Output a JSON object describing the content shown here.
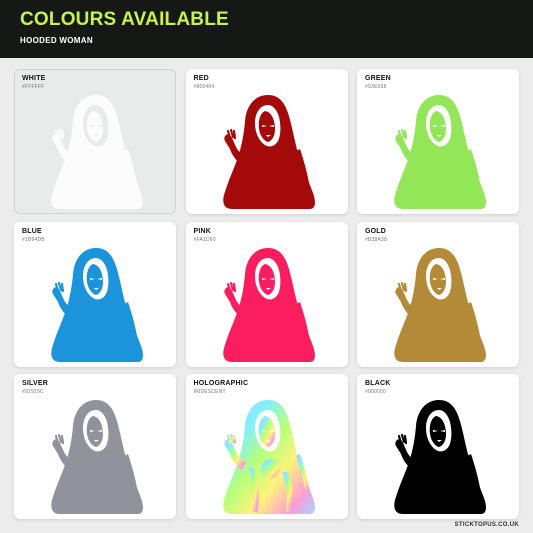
{
  "header": {
    "title": "COLOURS AVAILABLE",
    "subtitle": "HOODED WOMAN"
  },
  "colors": [
    {
      "name": "WHITE",
      "hex_label": "#FFFFFF",
      "fill": "#FFFFFF"
    },
    {
      "name": "RED",
      "hex_label": "#800404",
      "fill": "#A40A0A"
    },
    {
      "name": "GREEN",
      "hex_label": "#93E658",
      "fill": "#93E658"
    },
    {
      "name": "BLUE",
      "hex_label": "#1B94DB",
      "fill": "#1B94DB"
    },
    {
      "name": "PINK",
      "hex_label": "#FA1D60",
      "fill": "#FA1D60"
    },
    {
      "name": "GOLD",
      "hex_label": "#B38A38",
      "fill": "#B38A38"
    },
    {
      "name": "SILVER",
      "hex_label": "#92929C",
      "fill": "#92929C"
    },
    {
      "name": "HOLOGRAPHIC",
      "hex_label": "IRIDESCENT",
      "fill": "holographic"
    },
    {
      "name": "BLACK",
      "hex_label": "#000000",
      "fill": "#000000"
    }
  ],
  "footer": {
    "site": "STICKTOPUS.CO.UK"
  }
}
